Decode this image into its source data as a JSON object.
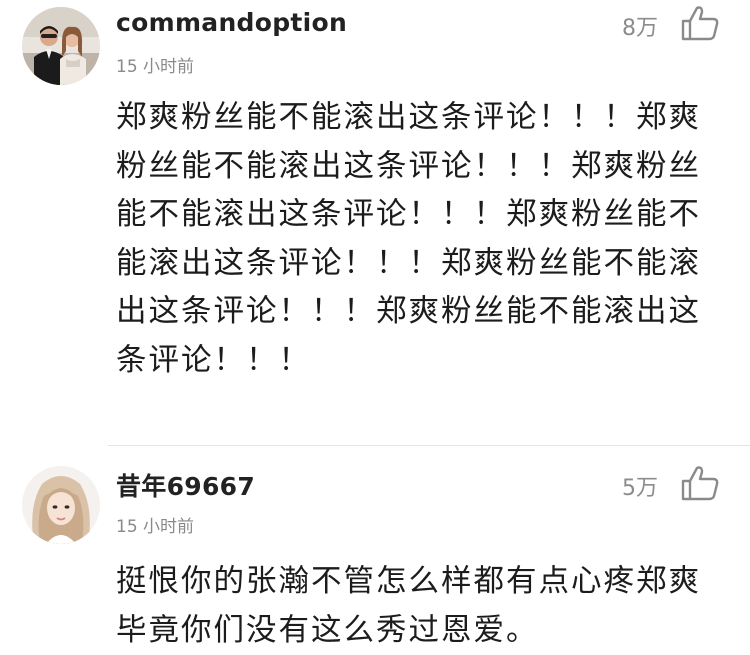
{
  "comments": [
    {
      "username": "commandoption",
      "time": "15 小时前",
      "likes": "8万",
      "text": "郑爽粉丝能不能滚出这条评论！！！郑爽粉丝能不能滚出这条评论！！！郑爽粉丝能不能滚出这条评论！！！郑爽粉丝能不能滚出这条评论！！！郑爽粉丝能不能滚出这条评论！！！郑爽粉丝能不能滚出这条评论！！！",
      "avatar_icon": "couple-photo-avatar",
      "like_icon": "thumbs-up-outline-icon"
    },
    {
      "username": "昔年69667",
      "time": "15 小时前",
      "likes": "5万",
      "text": "挺恨你的张瀚不管怎么样都有点心疼郑爽毕竟你们没有这么秀过恩爱。",
      "avatar_icon": "girl-photo-avatar",
      "like_icon": "thumbs-up-outline-icon"
    }
  ],
  "colors": {
    "username": "#222222",
    "meta": "#8a8a8a",
    "body": "#1c1c1c",
    "divider": "#e4e4e4"
  }
}
